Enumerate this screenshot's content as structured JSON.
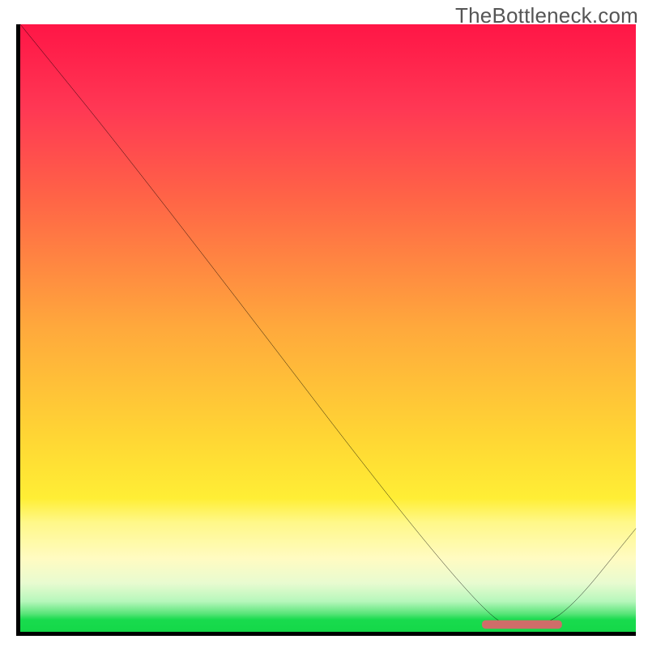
{
  "attribution": "TheBottleneck.com",
  "chart_data": {
    "type": "line",
    "title": "",
    "xlabel": "",
    "ylabel": "",
    "xlim": [
      0,
      100
    ],
    "ylim": [
      0,
      100
    ],
    "grid": false,
    "legend": false,
    "series": [
      {
        "name": "curve",
        "x": [
          0,
          20,
          75,
          82,
          88,
          100
        ],
        "y": [
          100,
          75,
          2,
          1,
          2,
          17
        ]
      }
    ],
    "marker": {
      "name": "optimal-range",
      "x_start": 75,
      "x_end": 88,
      "y": 1.2,
      "color": "#cf6d69"
    },
    "background_bands": [
      {
        "y_start": 0,
        "y_end": 2,
        "color": "#14d848"
      },
      {
        "y_start": 2,
        "y_end": 5,
        "color": "#5ae57a"
      },
      {
        "y_start": 5,
        "y_end": 8,
        "color": "#b6f7bb"
      },
      {
        "y_start": 8,
        "y_end": 12,
        "color": "#e8fbd0"
      },
      {
        "y_start": 12,
        "y_end": 18,
        "color": "#fffbc2"
      },
      {
        "y_start": 18,
        "y_end": 22,
        "color": "#fff889"
      },
      {
        "y_start": 22,
        "y_end": 32,
        "color": "#ffee35"
      },
      {
        "y_start": 32,
        "y_end": 50,
        "color": "#ffd634"
      },
      {
        "y_start": 50,
        "y_end": 72,
        "color": "#ffa93c"
      },
      {
        "y_start": 72,
        "y_end": 86,
        "color": "#ff6247"
      },
      {
        "y_start": 86,
        "y_end": 100,
        "color": "#ff1646"
      }
    ]
  }
}
